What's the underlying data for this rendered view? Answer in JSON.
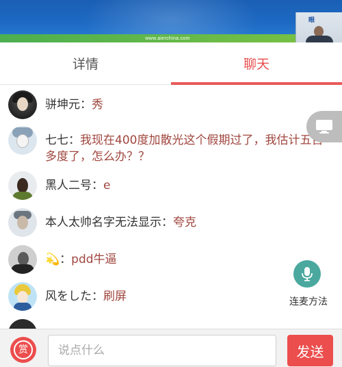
{
  "video": {
    "banner_url": "www.aierchina.com",
    "speaker_logo": "眼"
  },
  "tabs": [
    {
      "label": "详情",
      "active": false
    },
    {
      "label": "聊天",
      "active": true
    }
  ],
  "messages": [
    {
      "author": "骈坤元：",
      "content": "秀"
    },
    {
      "author": "七七：",
      "content": "我现在400度加散光这个假期过了，我估计五百多度了，怎么办？？"
    },
    {
      "author": "黑人二号：",
      "content": "e"
    },
    {
      "author": "本人太帅名字无法显示：",
      "content": "夸克"
    },
    {
      "author": "：",
      "author_emoji": "💫",
      "content": "pdd牛逼"
    },
    {
      "author": "风をした：",
      "content": "刷屏"
    }
  ],
  "mic": {
    "label": "连麦方法"
  },
  "bottom_bar": {
    "reward_label": "赏",
    "input_placeholder": "说点什么",
    "input_value": "",
    "send_label": "发送"
  },
  "colors": {
    "accent_red": "#ec4d4d",
    "tab_active": "#e84c4c",
    "message_content": "#a0463e",
    "mic_teal": "#4aa89f"
  },
  "icons": {
    "reward": "reward-icon",
    "mic": "microphone-icon",
    "screen": "screen-toggle-icon"
  }
}
